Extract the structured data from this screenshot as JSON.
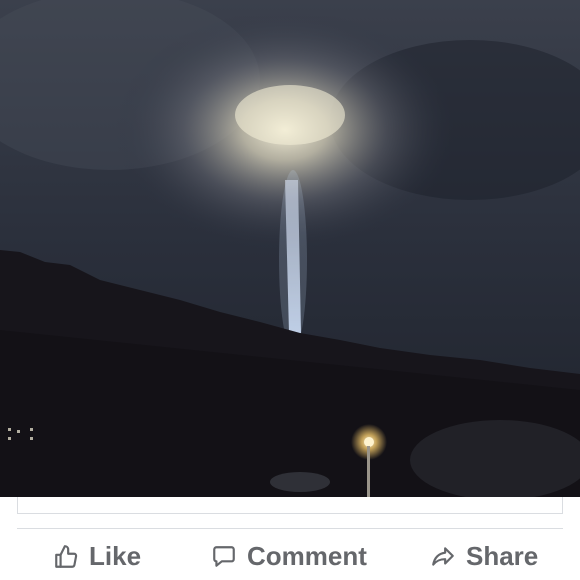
{
  "post": {
    "photo": {
      "subject": "night-sky-light-beam",
      "colors": {
        "sky": "#2b3140",
        "glow": "#e9e3c9",
        "beam": "#cfe3ff",
        "hill": "#15131a"
      }
    }
  },
  "actions": {
    "like": {
      "label": "Like",
      "icon": "thumbs-up-icon"
    },
    "comment": {
      "label": "Comment",
      "icon": "speech-bubble-icon"
    },
    "share": {
      "label": "Share",
      "icon": "share-arrow-icon"
    }
  },
  "colors": {
    "action_text": "#65676b",
    "divider": "#dadde1"
  }
}
